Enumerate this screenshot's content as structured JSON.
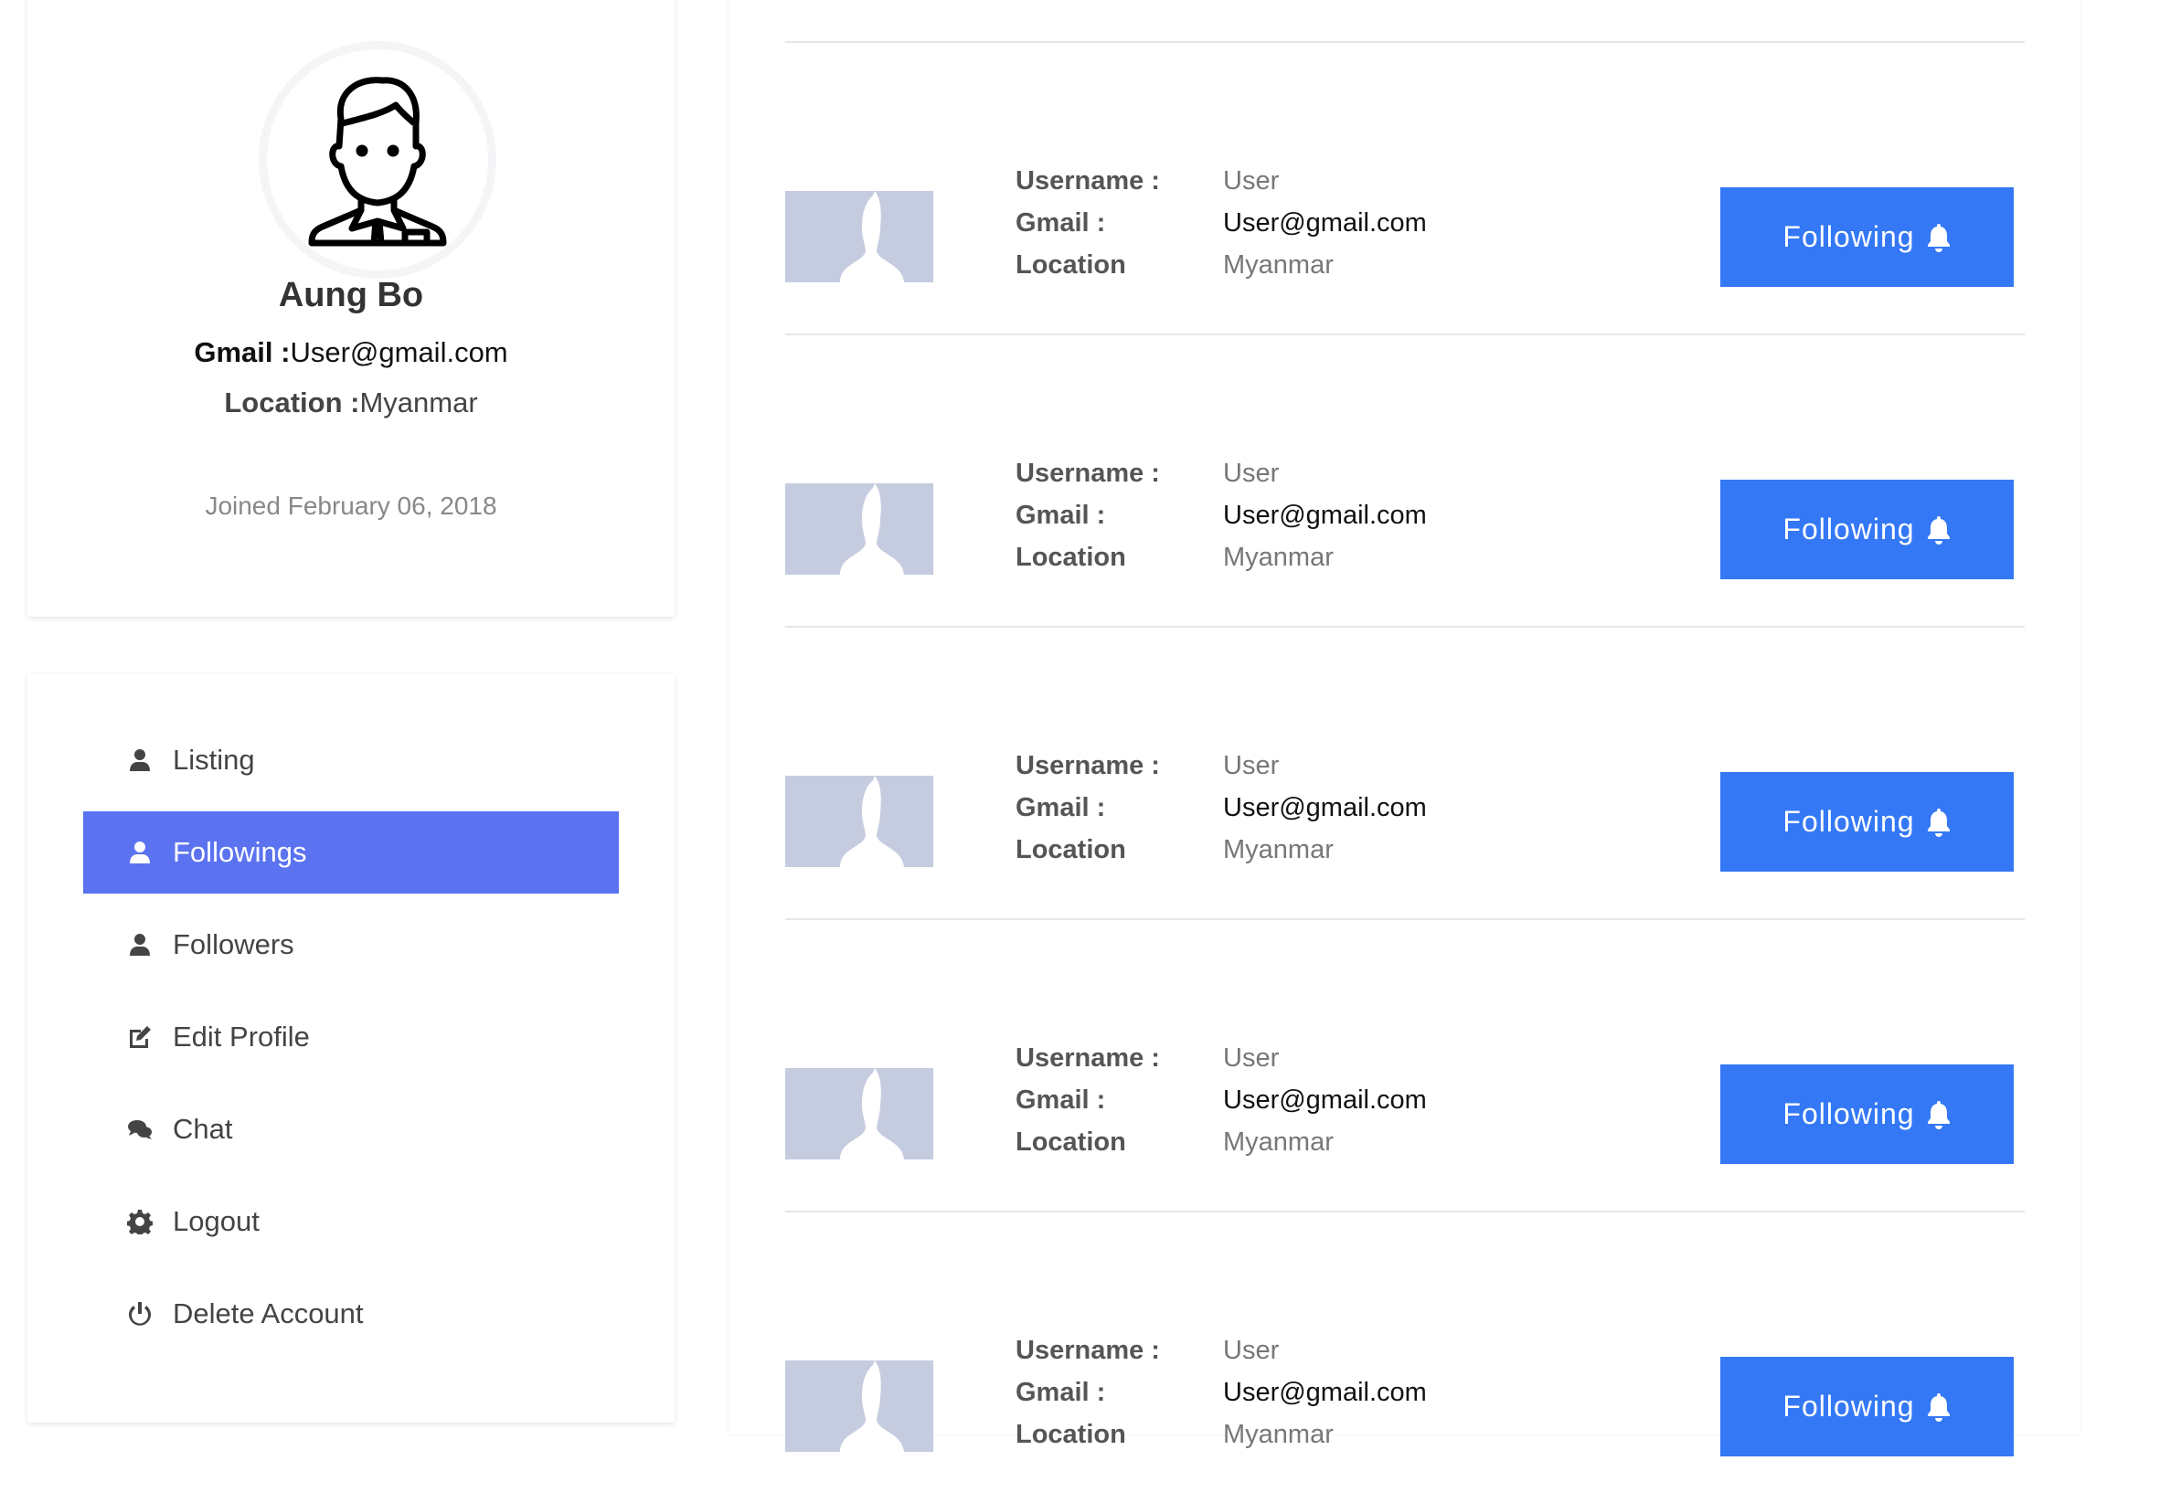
{
  "profile": {
    "name": "Aung Bo",
    "gmail_label": "Gmail :",
    "gmail": "User@gmail.com",
    "location_label": "Location :",
    "location": "Myanmar",
    "joined": "Joined February 06, 2018"
  },
  "menu": [
    {
      "label": "Listing",
      "icon": "user-icon",
      "active": false
    },
    {
      "label": "Followings",
      "icon": "user-icon",
      "active": true
    },
    {
      "label": "Followers",
      "icon": "user-icon",
      "active": false
    },
    {
      "label": "Edit Profile",
      "icon": "edit-icon",
      "active": false
    },
    {
      "label": "Chat",
      "icon": "chat-icon",
      "active": false
    },
    {
      "label": "Logout",
      "icon": "gear-icon",
      "active": false
    },
    {
      "label": "Delete Account",
      "icon": "power-icon",
      "active": false
    }
  ],
  "labels": {
    "username": "Username :",
    "gmail": "Gmail :",
    "location": "Location"
  },
  "followings": [
    {
      "username": "User",
      "gmail": "User@gmail.com",
      "location": "Myanmar",
      "button": "Following"
    },
    {
      "username": "User",
      "gmail": "User@gmail.com",
      "location": "Myanmar",
      "button": "Following"
    },
    {
      "username": "User",
      "gmail": "User@gmail.com",
      "location": "Myanmar",
      "button": "Following"
    },
    {
      "username": "User",
      "gmail": "User@gmail.com",
      "location": "Myanmar",
      "button": "Following"
    },
    {
      "username": "User",
      "gmail": "User@gmail.com",
      "location": "Myanmar",
      "button": "Following"
    }
  ],
  "colors": {
    "active_menu": "#5b73f0",
    "button": "#3478f6",
    "placeholder": "#c5ccdf"
  }
}
